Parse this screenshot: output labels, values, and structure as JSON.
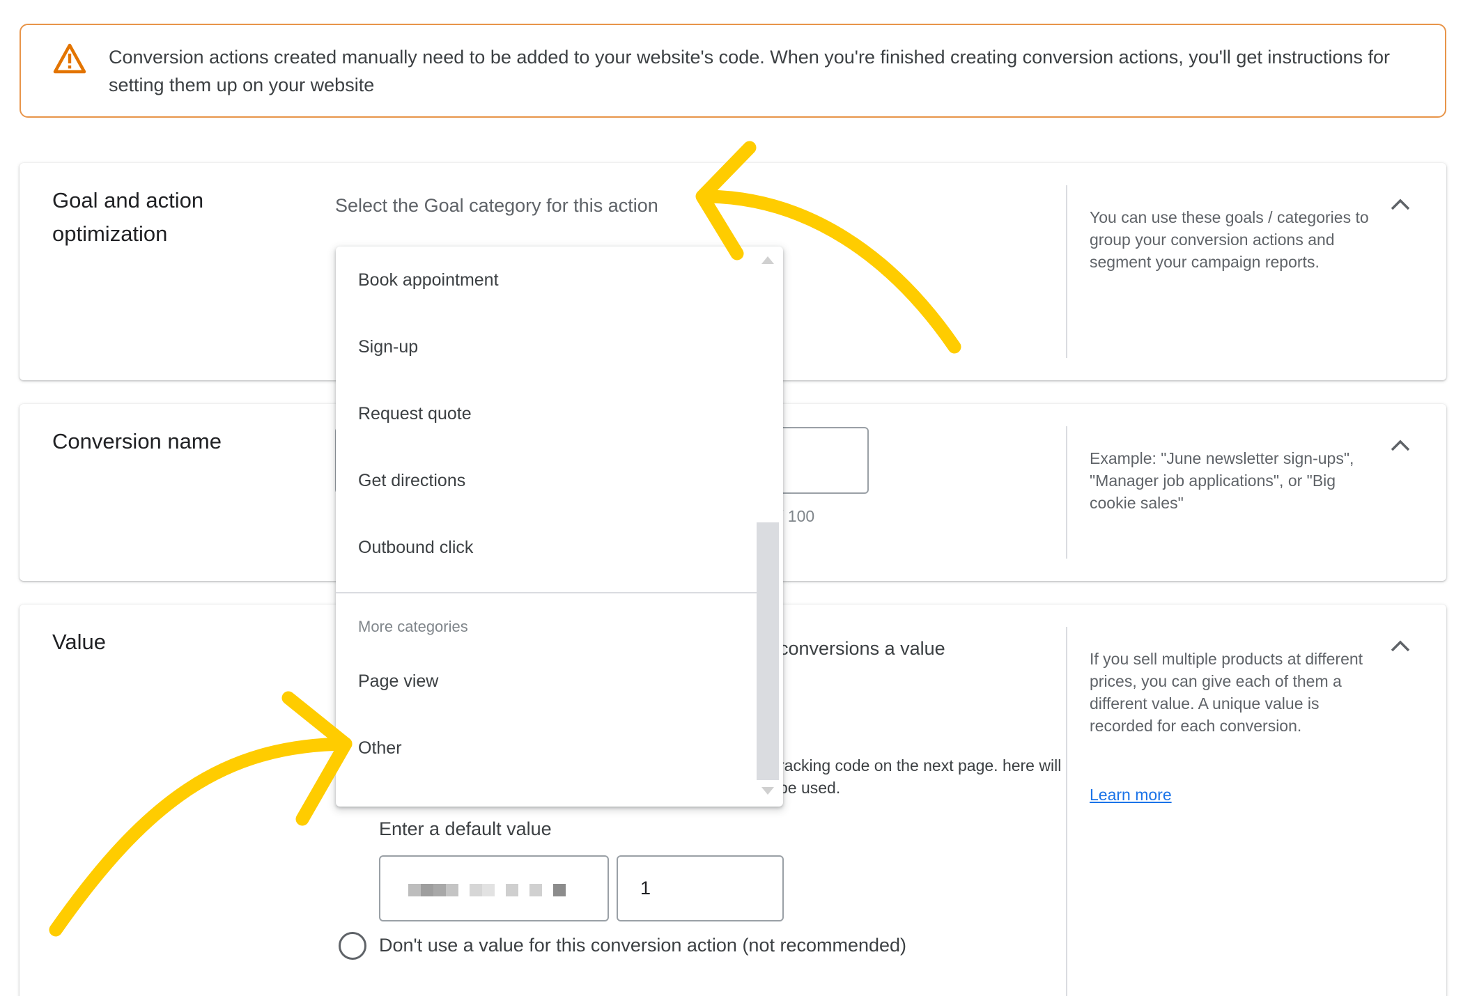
{
  "warning": {
    "text": "Conversion actions created manually need to be added to your website's code. When you're finished creating conversion actions, you'll get instructions for setting them up on your website"
  },
  "goal_card": {
    "title": "Goal and action optimization",
    "select_label": "Select the Goal category for this action",
    "help": "You can use these goals / categories to group your conversion actions and segment your campaign reports."
  },
  "name_card": {
    "title": "Conversion name",
    "char_count": "/ 100",
    "help": "Example: \"June newsletter sign-ups\", \"Manager job applications\", or \"Big cookie sales\""
  },
  "value_card": {
    "title": "Value",
    "option_text": "conversions a value",
    "note": "racking code on the next page. here will be used.",
    "default_label": "Enter a default value",
    "default_value": "1",
    "no_value_label": "Don't use a value for this conversion action (not recommended)",
    "help": "If you sell multiple products at different prices, you can give each of them a different value. A unique value is recorded for each conversion.",
    "learn_more": "Learn more"
  },
  "dropdown": {
    "items": [
      "Book appointment",
      "Sign-up",
      "Request quote",
      "Get directions",
      "Outbound click"
    ],
    "group_label": "More categories",
    "more_items": [
      "Page view",
      "Other"
    ]
  },
  "colors": {
    "annotation_arrow": "#FFCC00",
    "warning_border": "#E8954A",
    "warning_icon": "#E37400",
    "link": "#1A73E8"
  },
  "icons": [
    "warning-icon",
    "chevron-up-icon",
    "radio-icon",
    "annotation-arrow"
  ]
}
